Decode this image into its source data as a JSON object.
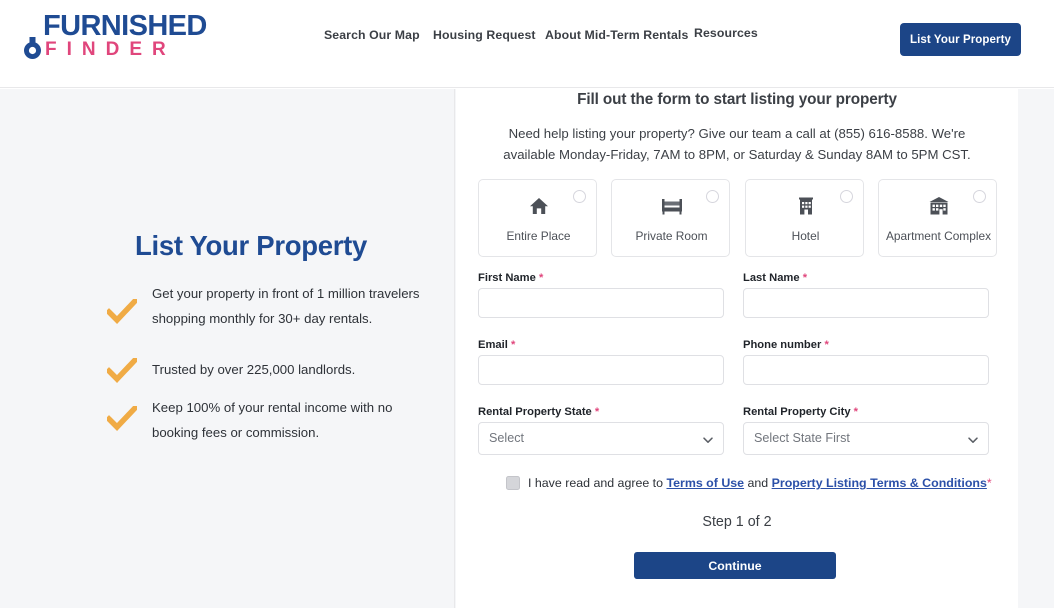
{
  "header": {
    "logo": {
      "top_text": "FURNISHED",
      "bottom_text": "FINDER",
      "top_color": "#1f4b93",
      "bottom_color": "#e0467c"
    },
    "nav": [
      {
        "label": "Search Our Map"
      },
      {
        "label": "Housing Request"
      },
      {
        "label": "About Mid-Term Rentals"
      },
      {
        "label": "Resources"
      }
    ],
    "cta_label": "List Your Property",
    "cta_color": "#1c4587"
  },
  "left_panel": {
    "title": "List Your Property",
    "title_color": "#1f4b93",
    "check_color": "#f0ab45",
    "benefits": [
      {
        "text": "Get your property in front of 1 million travelers shopping monthly for 30+ day rentals."
      },
      {
        "text": "Trusted by over 225,000 landlords."
      },
      {
        "text": "Keep 100% of your rental income with no booking fees or commission."
      }
    ]
  },
  "form": {
    "title": "Fill out the form to start listing your property",
    "subtitle": "Need help listing your property? Give our team a call at (855) 616-8588. We're available Monday-Friday, 7AM to 8PM, or Saturday & Sunday 8AM to 5PM CST.",
    "property_types": [
      {
        "label": "Entire Place",
        "icon": "home-icon",
        "selected": false
      },
      {
        "label": "Private Room",
        "icon": "bed-icon",
        "selected": false
      },
      {
        "label": "Hotel",
        "icon": "hotel-icon",
        "selected": false
      },
      {
        "label": "Apartment Complex",
        "icon": "apartment-icon",
        "selected": false
      }
    ],
    "fields": {
      "first_name": {
        "label": "First Name",
        "required": "*",
        "value": "",
        "placeholder": ""
      },
      "last_name": {
        "label": "Last Name",
        "required": "*",
        "value": "",
        "placeholder": ""
      },
      "email": {
        "label": "Email",
        "required": "*",
        "value": "",
        "placeholder": ""
      },
      "phone": {
        "label": "Phone number",
        "required": "*",
        "value": "",
        "placeholder": ""
      },
      "state": {
        "label": "Rental Property State",
        "required": "*",
        "selected": "Select"
      },
      "city": {
        "label": "Rental Property City",
        "required": "*",
        "selected": "Select State First"
      }
    },
    "agreement": {
      "checked": false,
      "prefix": "I have read and agree to ",
      "link1": "Terms of Use",
      "middle": " and ",
      "link2": "Property Listing Terms & Conditions",
      "required": "*",
      "link_color": "#2b50a8"
    },
    "step_text": "Step 1 of 2",
    "continue_label": "Continue"
  }
}
